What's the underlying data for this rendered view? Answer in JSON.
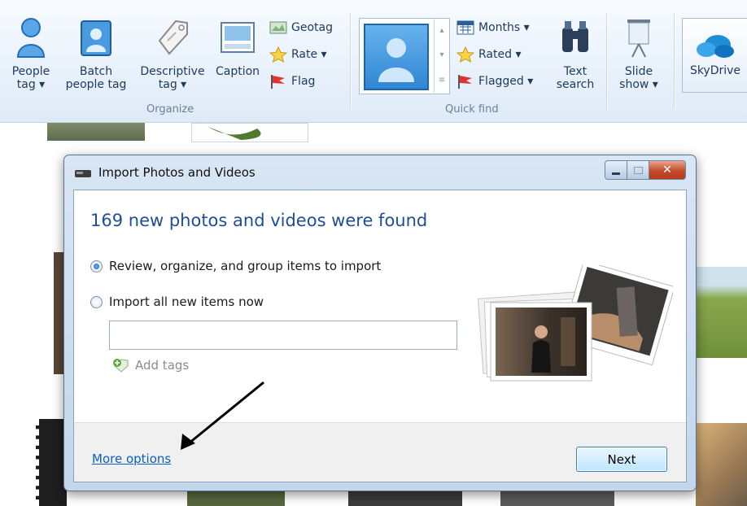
{
  "ribbon": {
    "people_tag": [
      "People",
      "tag ▾"
    ],
    "batch_people_tag": [
      "Batch",
      "people tag"
    ],
    "descriptive_tag": [
      "Descriptive",
      "tag ▾"
    ],
    "caption": "Caption",
    "geotag": "Geotag",
    "rate": "Rate ▾",
    "flag": "Flag",
    "organize_label": "Organize",
    "months": "Months ▾",
    "rated": "Rated ▾",
    "flagged": "Flagged ▾",
    "text_search": [
      "Text",
      "search"
    ],
    "slide_show": [
      "Slide",
      "show ▾"
    ],
    "quick_find_label": "Quick find",
    "skydrive": "SkyDrive"
  },
  "dialog": {
    "title": "Import Photos and Videos",
    "heading": "169 new photos and videos were found",
    "option_review": "Review, organize, and group items to import",
    "option_import_all": "Import all new items now",
    "selected_option": "review",
    "tags_value": "",
    "add_tags": "Add tags",
    "more_options": "More options",
    "next": "Next"
  }
}
